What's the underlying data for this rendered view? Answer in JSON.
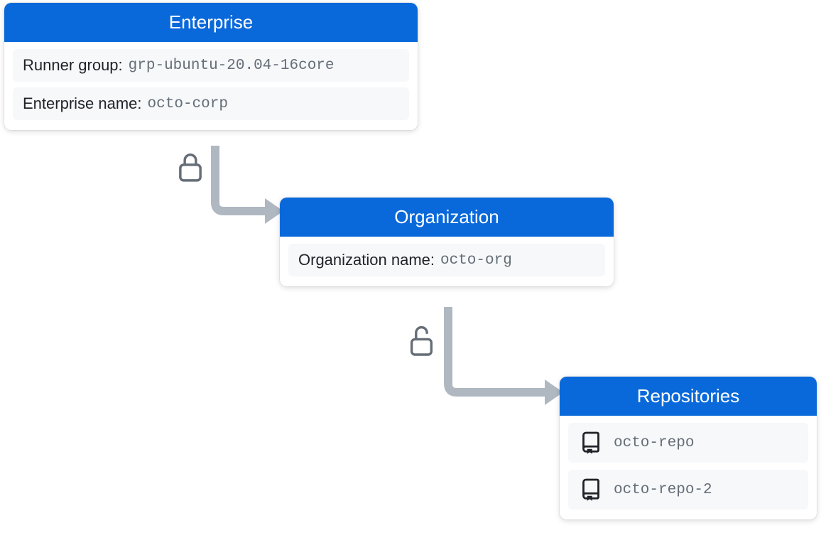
{
  "enterprise": {
    "title": "Enterprise",
    "runner_group_label": "Runner group:",
    "runner_group_value": "grp-ubuntu-20.04-16core",
    "name_label": "Enterprise name:",
    "name_value": "octo-corp"
  },
  "organization": {
    "title": "Organization",
    "name_label": "Organization name:",
    "name_value": "octo-org"
  },
  "repositories": {
    "title": "Repositories",
    "repo1": "octo-repo",
    "repo2": "octo-repo-2"
  }
}
